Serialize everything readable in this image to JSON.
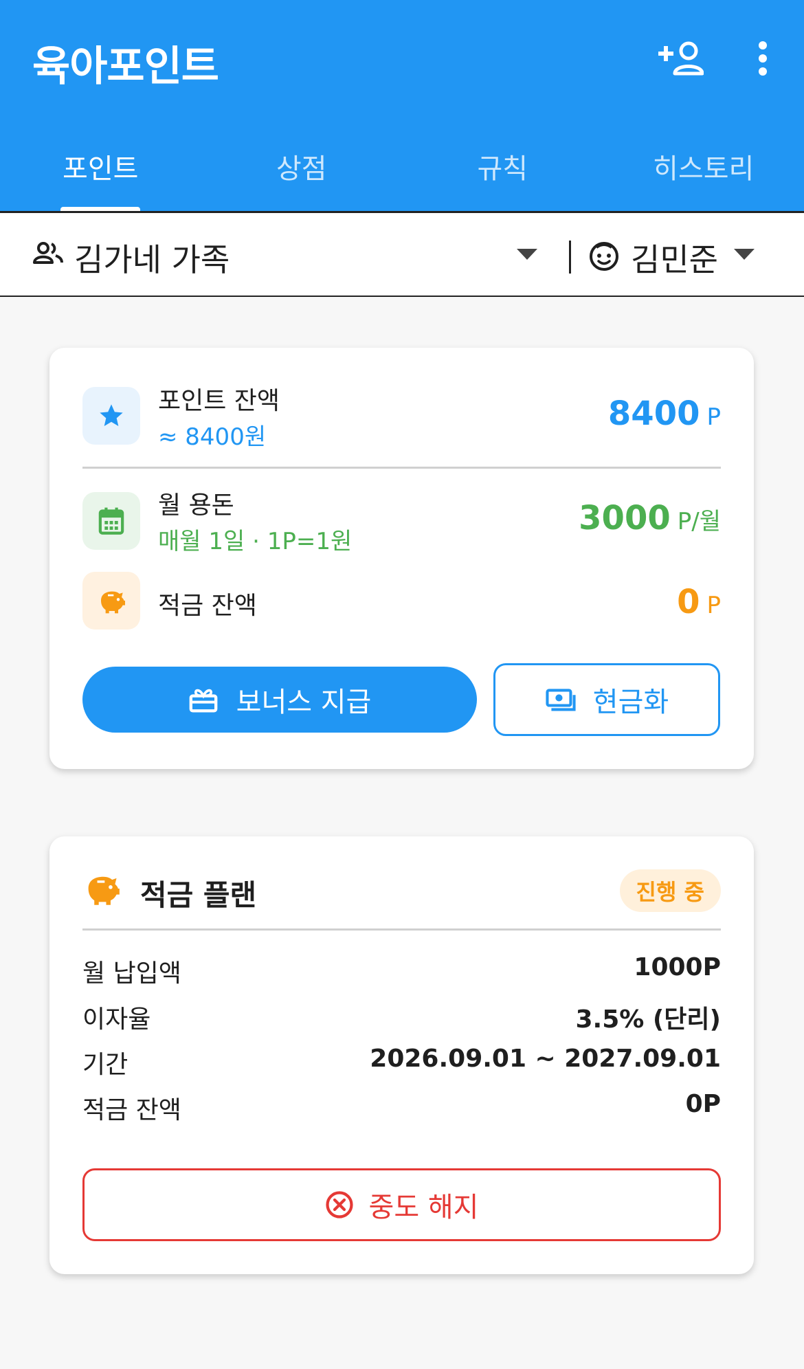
{
  "app": {
    "title": "육아포인트"
  },
  "tabs": [
    {
      "label": "포인트"
    },
    {
      "label": "상점"
    },
    {
      "label": "규칙"
    },
    {
      "label": "히스토리"
    }
  ],
  "selector": {
    "family": "김가네 가족",
    "child": "김민준"
  },
  "summary": {
    "points": {
      "label": "포인트 잔액",
      "sub": "≈ 8400원",
      "value": "8400",
      "unit": "P"
    },
    "allowance": {
      "label": "월 용돈",
      "sub": "매월 1일 · 1P=1원",
      "value": "3000",
      "unit": "P/월"
    },
    "savings": {
      "label": "적금 잔액",
      "value": "0",
      "unit": "P"
    },
    "bonus_label": "보너스 지급",
    "cash_label": "현금화"
  },
  "plan": {
    "title": "적금 플랜",
    "status": "진행 중",
    "rows": [
      {
        "k": "월 납입액",
        "v": "1000P"
      },
      {
        "k": "이자율",
        "v": "3.5% (단리)"
      },
      {
        "k": "기간",
        "v": "2026.09.01 ~ 2027.09.01"
      },
      {
        "k": "적금 잔액",
        "v": "0P"
      }
    ],
    "cancel_label": "중도 해지"
  },
  "colors": {
    "primary": "#2196f3",
    "green": "#4caf50",
    "orange": "#f79a13",
    "danger": "#e53935"
  }
}
